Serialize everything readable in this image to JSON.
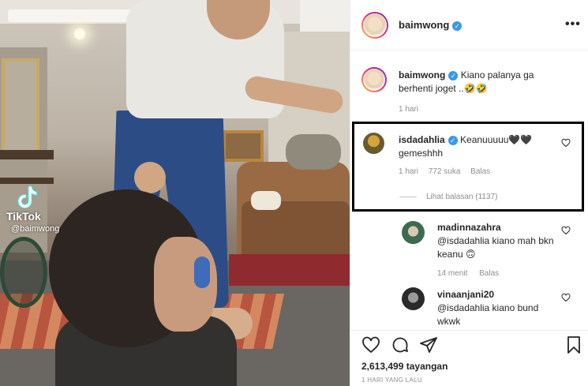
{
  "video": {
    "watermark_brand": "TikTok",
    "watermark_handle": "@baimwong"
  },
  "post": {
    "author": "baimwong",
    "more_label": "•••"
  },
  "caption": {
    "author": "baimwong",
    "text": "Kiano palanya ga berhenti joget ..🤣🤣",
    "time": "1 hari"
  },
  "highlighted_comment": {
    "author": "isdadahlia",
    "text": "Keanuuuuu🖤🖤 gemeshhh",
    "time": "1 hari",
    "likes": "772 suka",
    "reply_label": "Balas",
    "view_replies": "Lihat balasan (1137)"
  },
  "replies": [
    {
      "author": "madinnazahra",
      "text": "@isdadahlia kiano mah bkn keanu 🙃",
      "time": "14 menit",
      "reply_label": "Balas"
    },
    {
      "author": "vinaanjani20",
      "text": "@isdadahlia kiano bund wkwk"
    }
  ],
  "stats": {
    "views": "2,613,499 tayangan",
    "posted": "1 HARI YANG LALU"
  },
  "colors": {
    "verified": "#3897f0",
    "muted_text": "#8e8e8e",
    "text": "#262626",
    "highlight_border": "#000000"
  }
}
